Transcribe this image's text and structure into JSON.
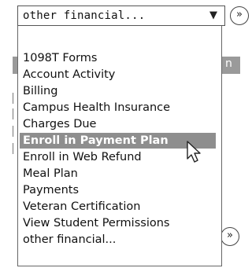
{
  "dropdown": {
    "selected_value": "other financial...",
    "arrow_icon": "triangle-down-icon"
  },
  "go_button": {
    "label": "»",
    "icon": "double-chevron-right-icon"
  },
  "background": {
    "partial_label": "n"
  },
  "menu": {
    "items": [
      {
        "label": "1098T Forms"
      },
      {
        "label": "Account Activity"
      },
      {
        "label": "Billing"
      },
      {
        "label": "Campus Health Insurance"
      },
      {
        "label": "Charges Due"
      },
      {
        "label": "Enroll in Payment Plan"
      },
      {
        "label": "Enroll in Web Refund"
      },
      {
        "label": "Meal Plan"
      },
      {
        "label": "Payments"
      },
      {
        "label": "Veteran Certification"
      },
      {
        "label": "View Student Permissions"
      },
      {
        "label": "other financial..."
      }
    ],
    "highlighted_index": 5
  },
  "colors": {
    "highlight": "#8e8e8e",
    "border": "#555555"
  }
}
